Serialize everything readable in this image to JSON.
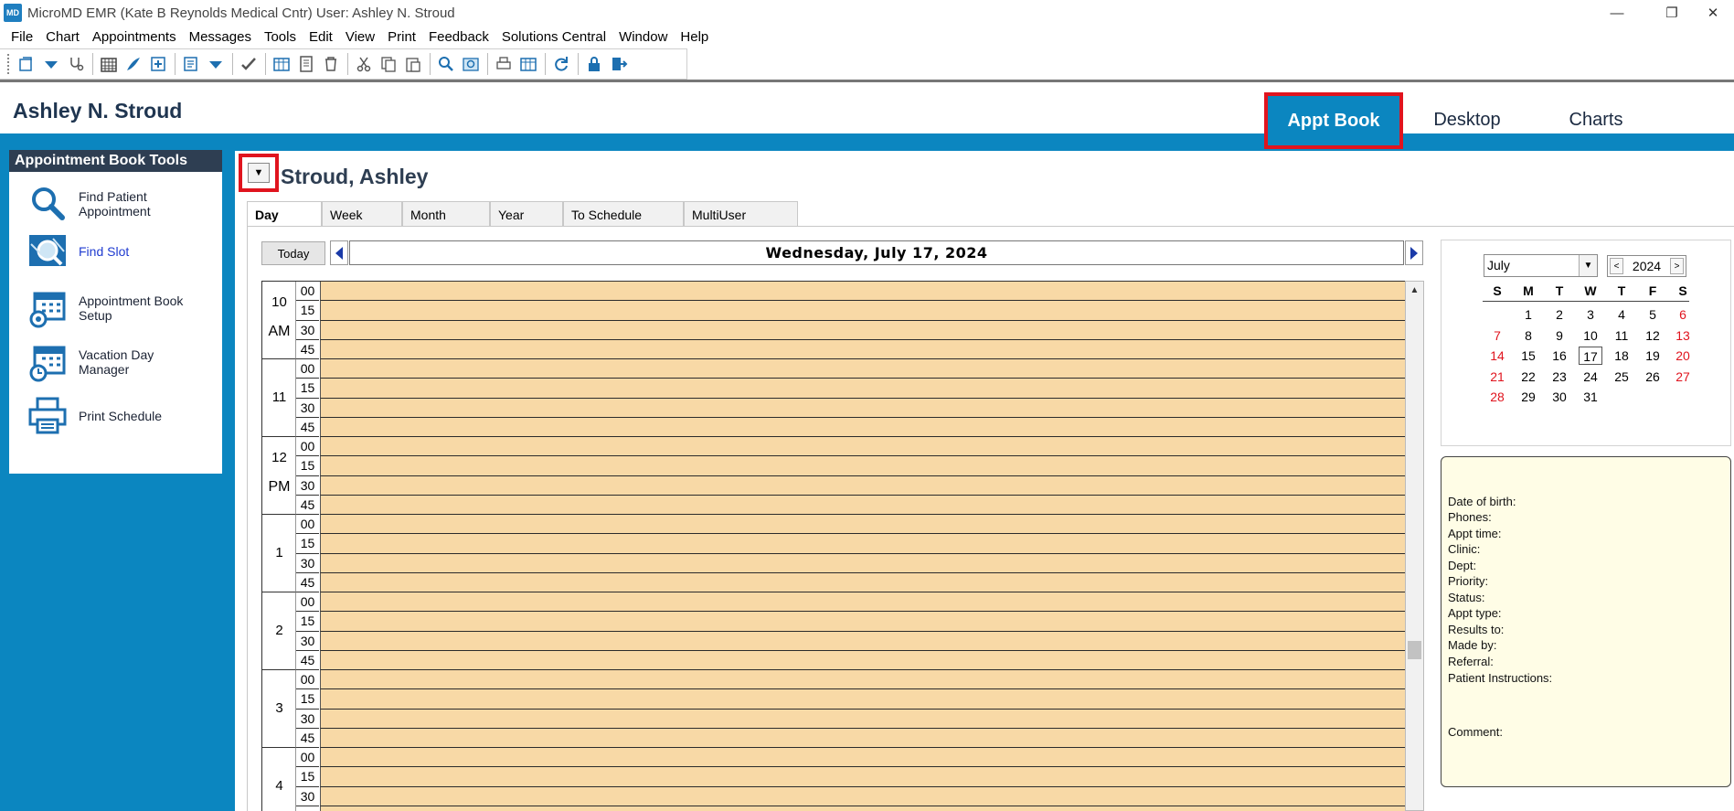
{
  "window": {
    "title": "MicroMD EMR (Kate B Reynolds Medical  Cntr)  User: Ashley N. Stroud",
    "logo": "MD",
    "minimize_glyph": "—",
    "restore_glyph": "❐",
    "close_glyph": "✕"
  },
  "menu": [
    "File",
    "Chart",
    "Appointments",
    "Messages",
    "Tools",
    "Edit",
    "View",
    "Print",
    "Feedback",
    "Solutions Central",
    "Window",
    "Help"
  ],
  "header": {
    "user_name": "Ashley N. Stroud",
    "tabs": [
      "Appt Book",
      "Desktop",
      "Charts"
    ]
  },
  "tools": {
    "title": "Appointment Book Tools",
    "items": [
      {
        "label": "Find Patient Appointment",
        "icon": "magnifier-icon"
      },
      {
        "label": "Find Slot",
        "icon": "find-slot-icon"
      },
      {
        "label": "Appointment Book Setup",
        "icon": "calendar-gear-icon"
      },
      {
        "label": "Vacation Day Manager",
        "icon": "calendar-clock-icon"
      },
      {
        "label": "Print Schedule",
        "icon": "printer-icon"
      }
    ]
  },
  "provider": {
    "name": "Stroud,  Ashley",
    "dropdown_glyph": "▼"
  },
  "view_tabs": [
    "Day",
    "Week",
    "Month",
    "Year",
    "To Schedule",
    "MultiUser"
  ],
  "day_nav": {
    "today_label": "Today",
    "date": "Wednesday, July 17, 2024"
  },
  "schedule": {
    "hours": [
      {
        "hour": "10",
        "ampm": "AM"
      },
      {
        "hour": "11",
        "ampm": ""
      },
      {
        "hour": "12",
        "ampm": "PM"
      },
      {
        "hour": "1",
        "ampm": ""
      },
      {
        "hour": "2",
        "ampm": ""
      },
      {
        "hour": "3",
        "ampm": ""
      },
      {
        "hour": "4",
        "ampm": ""
      }
    ],
    "minutes": [
      "00",
      "15",
      "30",
      "45"
    ],
    "slot_color": "#f8d9a6"
  },
  "calendar": {
    "month": "July",
    "year": "2024",
    "dow": [
      "S",
      "M",
      "T",
      "W",
      "T",
      "F",
      "S"
    ],
    "first_weekday": 1,
    "days_in_month": 31,
    "selected_day": 17
  },
  "info": {
    "labels": [
      "Date of birth:",
      "Phones:",
      "Appt time:",
      "Clinic:",
      "Dept:",
      "Priority:",
      "Status:",
      "Appt type:",
      "Results to:",
      "Made by:",
      "Referral:",
      "Patient Instructions:",
      "Comment:"
    ]
  },
  "colors": {
    "accent_blue": "#0b86c0",
    "highlight_red": "#e0141e",
    "slot_orange": "#f8d9a6",
    "weekend_red": "#e0141e"
  }
}
